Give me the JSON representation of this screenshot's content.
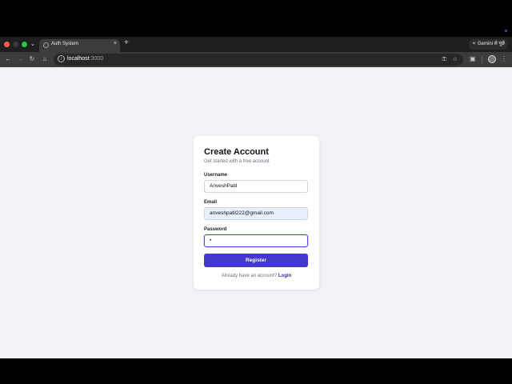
{
  "browser": {
    "tab_title": "Auth System",
    "tab_close": "×",
    "new_tab": "+",
    "gemini_label": "Gemini से पूछें",
    "url_host": "localhost",
    "url_port": ":3000"
  },
  "form": {
    "title": "Create Account",
    "subtitle": "Get started with a free account",
    "username_label": "Username",
    "username_value": "AnveshPatil",
    "email_label": "Email",
    "email_value": "anveshpatil222@gmail.com",
    "password_label": "Password",
    "password_value": "•",
    "register_label": "Register",
    "footer_text": "Already have an account?",
    "login_link": "Login"
  },
  "colors": {
    "primary": "#4338ca",
    "page_bg": "#f0f2f5",
    "autofill_bg": "#e8f0fe"
  },
  "icons": [
    "back-arrow-icon",
    "forward-arrow-icon",
    "reload-icon",
    "home-icon",
    "site-info-icon",
    "password-key-icon",
    "bookmark-star-icon",
    "extensions-icon",
    "profile-avatar-icon",
    "kebab-menu-icon",
    "gemini-sparkle-icon"
  ]
}
